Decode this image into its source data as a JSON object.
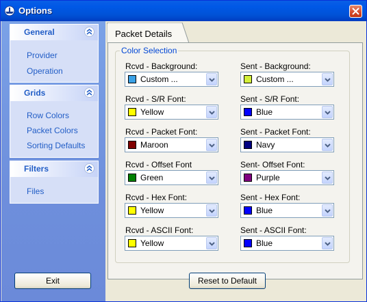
{
  "window": {
    "title": "Options",
    "close_icon": "close-icon"
  },
  "sidebar": {
    "groups": [
      {
        "title": "General",
        "items": [
          "Provider",
          "Operation"
        ]
      },
      {
        "title": "Grids",
        "items": [
          "Row Colors",
          "Packet Colors",
          "Sorting Defaults"
        ]
      },
      {
        "title": "Filters",
        "items": [
          "Files"
        ]
      }
    ],
    "exit_label": "Exit"
  },
  "tabs": [
    {
      "label": "Packet Details"
    }
  ],
  "color_selection": {
    "legend": "Color Selection",
    "fields": [
      {
        "label": "Rcvd - Background:",
        "value": "Custom ...",
        "color": "#3aa1e6"
      },
      {
        "label": "Sent - Background:",
        "value": "Custom ...",
        "color": "#d4f03a"
      },
      {
        "label": "Rcvd - S/R Font:",
        "value": "Yellow",
        "color": "#ffff00"
      },
      {
        "label": "Sent - S/R Font:",
        "value": "Blue",
        "color": "#0000ff"
      },
      {
        "label": "Rcvd - Packet Font:",
        "value": "Maroon",
        "color": "#800000"
      },
      {
        "label": "Sent - Packet Font:",
        "value": "Navy",
        "color": "#000080"
      },
      {
        "label": "Rcvd - Offset Font",
        "value": "Green",
        "color": "#008000"
      },
      {
        "label": "Sent- Offset Font:",
        "value": "Purple",
        "color": "#800080"
      },
      {
        "label": "Rcvd - Hex Font:",
        "value": "Yellow",
        "color": "#ffff00"
      },
      {
        "label": "Sent - Hex Font:",
        "value": "Blue",
        "color": "#0000ff"
      },
      {
        "label": "Rcvd - ASCII Font:",
        "value": "Yellow",
        "color": "#ffff00"
      },
      {
        "label": "Sent - ASCII Font:",
        "value": "Blue",
        "color": "#0000ff"
      }
    ]
  },
  "reset_label": "Reset to Default"
}
